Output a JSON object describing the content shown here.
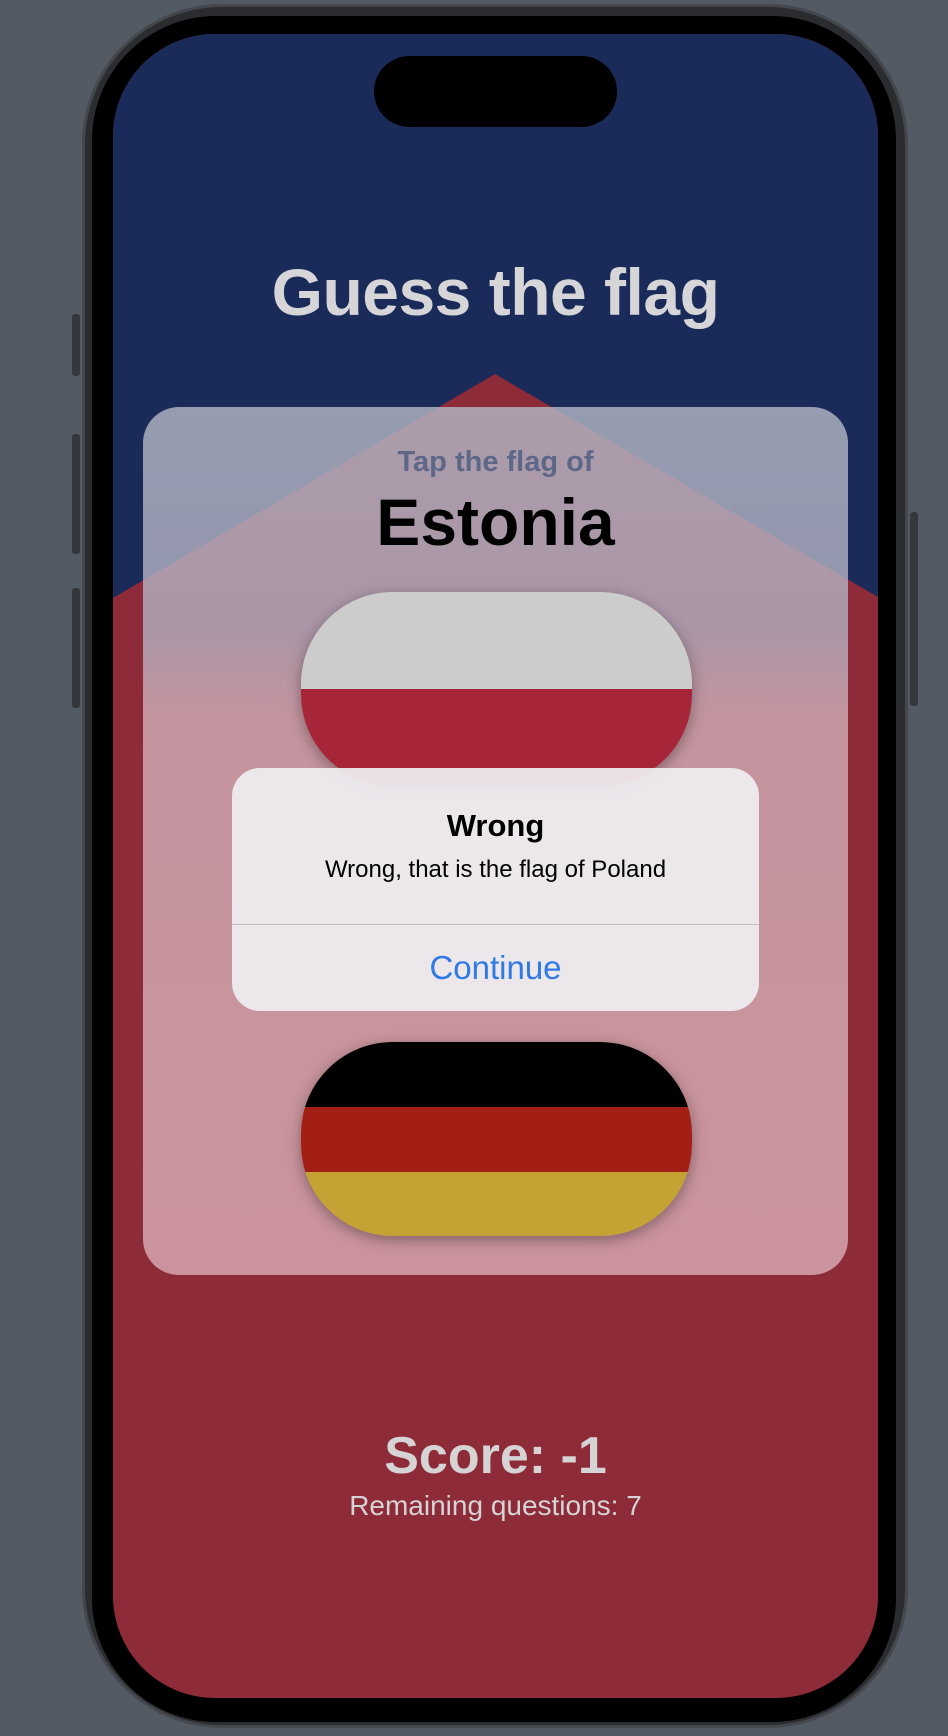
{
  "app": {
    "title": "Guess the flag"
  },
  "question": {
    "prompt": "Tap the flag of",
    "country": "Estonia"
  },
  "flags": [
    {
      "name": "Poland",
      "stripes": [
        "#cccccc",
        "#a62538"
      ]
    },
    {
      "name": "Germany",
      "stripes": [
        "#000000",
        "#a31f15",
        "#c4a234"
      ]
    }
  ],
  "alert": {
    "title": "Wrong",
    "message": "Wrong, that is the flag of Poland",
    "button_label": "Continue"
  },
  "score": {
    "label": "Score: -1",
    "remaining": "Remaining questions: 7"
  },
  "colors": {
    "background_top": "#1a2a59",
    "background_bottom": "#8d2b39",
    "accent_button": "#2f7ae5",
    "card_prompt": "#5d6787"
  }
}
